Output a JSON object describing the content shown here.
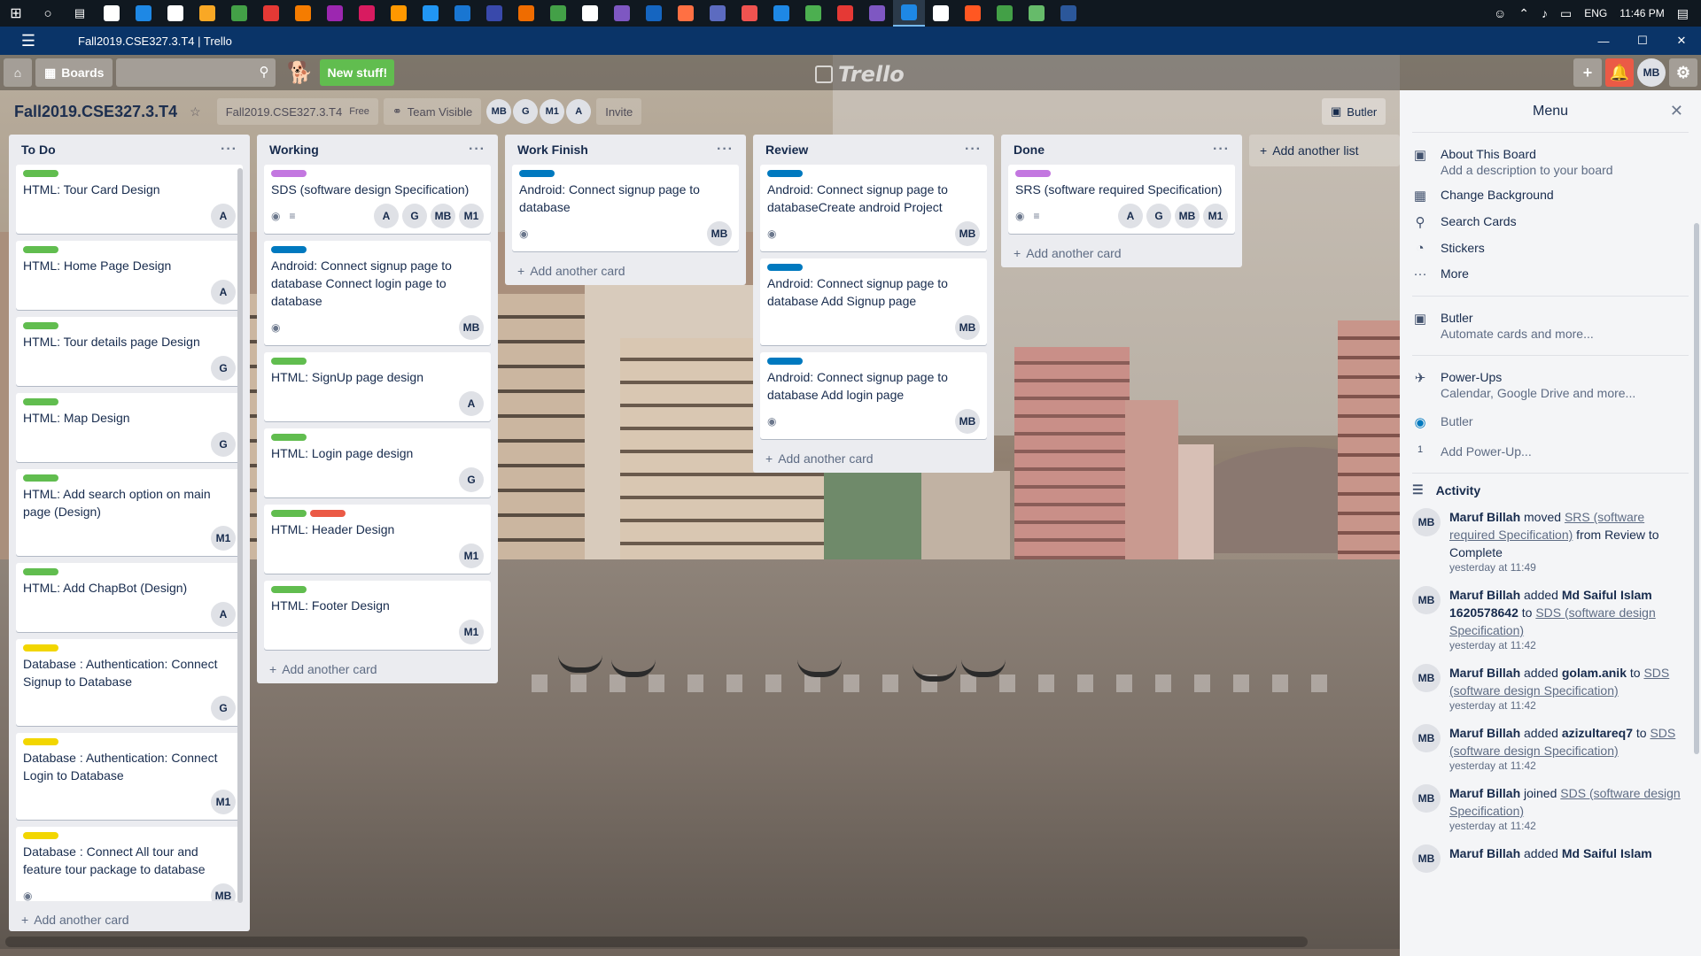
{
  "window": {
    "title": "Fall2019.CSE327.3.T4 | Trello"
  },
  "taskbar": {
    "tray": {
      "lang": "ENG",
      "time": "11:46 PM"
    },
    "apps": [
      "#ffffff",
      "#1e88e5",
      "#ffffff",
      "#f9a825",
      "#43a047",
      "#e53935",
      "#f57c00",
      "#9c27b0",
      "#d81b60",
      "#ff9800",
      "#2196f3",
      "#1976d2",
      "#3949ab",
      "#ef6c00",
      "#43a047",
      "#ffffff",
      "#7e57c2",
      "#1565c0",
      "#ff7043",
      "#5c6bc0",
      "#ef5350",
      "#1e88e5",
      "#4caf50",
      "#e53935",
      "#7e57c2",
      "#1e88e5",
      "#ffffff",
      "#ff5722",
      "#43a047",
      "#66bb6a",
      "#2b579a"
    ]
  },
  "header": {
    "boards_label": "Boards",
    "new_stuff": "New stuff!",
    "logo": "Trello",
    "user_initials": "MB"
  },
  "board": {
    "name": "Fall2019.CSE327.3.T4",
    "team": "Fall2019.CSE327.3.T4",
    "plan": "Free",
    "visibility": "Team Visible",
    "members": [
      "MB",
      "G",
      "M1",
      "A"
    ],
    "invite": "Invite",
    "butler": "Butler"
  },
  "lists": [
    {
      "title": "To Do",
      "add": "Add another card",
      "cards": [
        {
          "labels": [
            "#61bd4f"
          ],
          "title": "HTML: Tour Card Design",
          "members": [
            "A"
          ]
        },
        {
          "labels": [
            "#61bd4f"
          ],
          "title": "HTML: Home Page Design",
          "members": [
            "A"
          ]
        },
        {
          "labels": [
            "#61bd4f"
          ],
          "title": "HTML: Tour details page Design",
          "members": [
            "G"
          ]
        },
        {
          "labels": [
            "#61bd4f"
          ],
          "title": "HTML: Map Design",
          "members": [
            "G"
          ]
        },
        {
          "labels": [
            "#61bd4f"
          ],
          "title": "HTML: Add search option on main page (Design)",
          "members": [
            "M1"
          ]
        },
        {
          "labels": [
            "#61bd4f"
          ],
          "title": "HTML: Add ChapBot (Design)",
          "members": [
            "A"
          ]
        },
        {
          "labels": [
            "#f2d600"
          ],
          "title": "Database : Authentication: Connect Signup to Database",
          "members": [
            "G"
          ]
        },
        {
          "labels": [
            "#f2d600"
          ],
          "title": "Database : Authentication: Connect Login to Database",
          "members": [
            "M1"
          ]
        },
        {
          "labels": [
            "#f2d600"
          ],
          "title": "Database : Connect All tour and feature tour package to database",
          "members": [
            "MB"
          ],
          "watch": true
        }
      ]
    },
    {
      "title": "Working",
      "add": "Add another card",
      "cards": [
        {
          "labels": [
            "#c377e0"
          ],
          "title": "SDS (software design Specification)",
          "members": [
            "A",
            "G",
            "MB",
            "M1"
          ],
          "watch": true,
          "desc": true
        },
        {
          "labels": [
            "#0079bf"
          ],
          "title": "Android: Connect signup page to database Connect login page to database",
          "members": [
            "MB"
          ],
          "watch": true
        },
        {
          "labels": [
            "#61bd4f"
          ],
          "title": "HTML: SignUp page design",
          "members": [
            "A"
          ]
        },
        {
          "labels": [
            "#61bd4f"
          ],
          "title": "HTML: Login page design",
          "members": [
            "G"
          ]
        },
        {
          "labels": [
            "#61bd4f",
            "#eb5a46"
          ],
          "title": "HTML: Header Design",
          "members": [
            "M1"
          ]
        },
        {
          "labels": [
            "#61bd4f"
          ],
          "title": "HTML: Footer Design",
          "members": [
            "M1"
          ]
        }
      ]
    },
    {
      "title": "Work Finish",
      "add": "Add another card",
      "cards": [
        {
          "labels": [
            "#0079bf"
          ],
          "title": "Android: Connect signup page to database",
          "members": [
            "MB"
          ],
          "watch": true
        }
      ]
    },
    {
      "title": "Review",
      "add": "Add another card",
      "cards": [
        {
          "labels": [
            "#0079bf"
          ],
          "title": "Android: Connect signup page to databaseCreate android Project",
          "members": [
            "MB"
          ],
          "watch": true
        },
        {
          "labels": [
            "#0079bf"
          ],
          "title": "Android: Connect signup page to database Add Signup page",
          "members": [
            "MB"
          ]
        },
        {
          "labels": [
            "#0079bf"
          ],
          "title": "Android: Connect signup page to database Add login page",
          "members": [
            "MB"
          ],
          "watch": true
        }
      ]
    },
    {
      "title": "Done",
      "add": "Add another card",
      "cards": [
        {
          "labels": [
            "#c377e0"
          ],
          "title": "SRS (software required Specification)",
          "members": [
            "A",
            "G",
            "MB",
            "M1"
          ],
          "watch": true,
          "desc": true
        }
      ]
    }
  ],
  "add_list": "Add another list",
  "menu": {
    "title": "Menu",
    "items": [
      {
        "icon": "board-icon",
        "glyph": "▣",
        "title": "About This Board",
        "sub": "Add a description to your board"
      },
      {
        "icon": "background-icon",
        "glyph": "▦",
        "title": "Change Background",
        "sub": ""
      },
      {
        "icon": "search-icon",
        "glyph": "⚲",
        "title": "Search Cards",
        "sub": ""
      },
      {
        "icon": "sticker-icon",
        "glyph": "◔",
        "title": "Stickers",
        "sub": ""
      },
      {
        "icon": "more-icon",
        "glyph": "···",
        "title": "More",
        "sub": ""
      }
    ],
    "butler": {
      "title": "Butler",
      "sub": "Automate cards and more..."
    },
    "powerups": {
      "title": "Power-Ups",
      "sub": "Calendar, Google Drive and more...",
      "butler": "Butler",
      "count": "1",
      "add": "Add Power-Up..."
    },
    "activity_title": "Activity",
    "activity": [
      {
        "who": "Maruf Billah",
        "pre": " moved ",
        "link": "SRS (software required Specification)",
        "post": " from Review to Complete",
        "mid": "",
        "time": "yesterday at 11:49"
      },
      {
        "who": "Maruf Billah",
        "pre": " added ",
        "mid": "Md Saiful Islam 1620578642",
        "mid_post": " to ",
        "link": "SDS (software design Specification)",
        "post": "",
        "time": "yesterday at 11:42"
      },
      {
        "who": "Maruf Billah",
        "pre": " added ",
        "mid": "golam.anik",
        "mid_post": " to ",
        "link": "SDS (software design Specification)",
        "post": "",
        "time": "yesterday at 11:42"
      },
      {
        "who": "Maruf Billah",
        "pre": " added ",
        "mid": "azizultareq7",
        "mid_post": " to ",
        "link": "SDS (software design Specification)",
        "post": "",
        "time": "yesterday at 11:42"
      },
      {
        "who": "Maruf Billah",
        "pre": " joined ",
        "mid": "",
        "link": "SDS (software design Specification)",
        "post": "",
        "time": "yesterday at 11:42"
      },
      {
        "who": "Maruf Billah",
        "pre": " added ",
        "mid": "Md Saiful Islam",
        "mid_post": "",
        "link": "",
        "post": "",
        "time": ""
      }
    ],
    "activity_avatar": "MB"
  }
}
